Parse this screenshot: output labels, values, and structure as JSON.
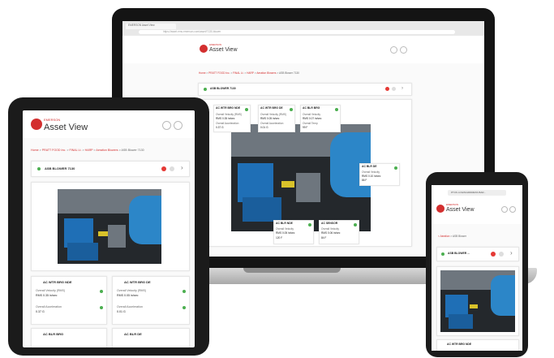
{
  "app": {
    "brand_small": "EMERSON",
    "brand_name": "Asset View",
    "asset_name_upper": "ASB BLOWER 7130",
    "asset_name_title": "ASB Blower 7130",
    "phone_asset_name": "ASB BLOWER ...",
    "phone_button": "PTUS LOGIN/ADDRESS BAR..."
  },
  "browser": {
    "tab_title": "EMERSON Asset View",
    "url": "https://asset.ems.emerson.com/asset/7130-blower"
  },
  "breadcrumb": {
    "home": "Home",
    "site": "PRATT FOOD Inc.",
    "area": "FINAL Lt.",
    "unit": "HARP",
    "group": "Aeration Blowers",
    "asset": "ASB Blower 7130",
    "phone_back": "< Aeration",
    "phone_current": "ASB Blower"
  },
  "sensors": {
    "s1": {
      "title": "AC WTR BRG NDE",
      "row1": "Overall Velocity (RMS)",
      "val1": "RMS 0.35 in/sec",
      "row2": "Overall Acceleration",
      "val2": "0.37 G"
    },
    "s2": {
      "title": "AC WTR BRG DE",
      "row1": "Overall Velocity (RMS)",
      "val1": "RMS 0.05 in/sec",
      "row2": "Overall Acceleration",
      "val2": "0.01 G"
    },
    "s3": {
      "title": "AC BLR BRG",
      "row1": "Overall Velocity",
      "val1": "RMS 0.07 in/sec",
      "row2": "Overall Temp",
      "val2": "99 F"
    },
    "s4": {
      "title": "AC BLR DE",
      "row1": "Overall Velocity",
      "val1": "RMS 0.10 in/sec",
      "row2": "Overall Temp",
      "val2": "86 F"
    },
    "s5": {
      "title": "AC BLR NDE",
      "row1": "Overall Velocity",
      "val1": "RMS 0.05 in/sec",
      "row2": "Overall Temp",
      "val2": "120 F"
    },
    "s6": {
      "title": "AC SENSOR",
      "row1": "Overall Velocity",
      "val1": "RMS 0.06 in/sec",
      "row2": "Overall Temp",
      "val2": "84 F"
    }
  },
  "colors": {
    "brand_red": "#d32f2f",
    "ok_green": "#4caf50",
    "motor_blue": "#1f6fb6"
  }
}
